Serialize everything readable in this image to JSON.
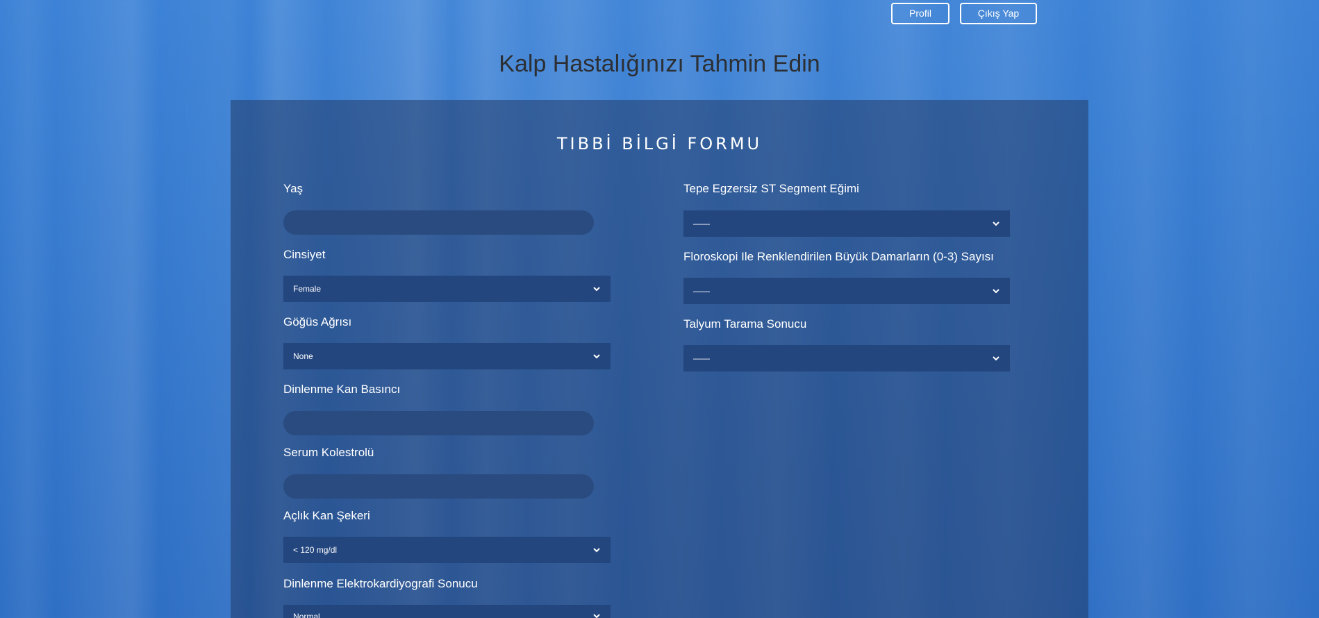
{
  "nav": {
    "profile_label": "Profil",
    "logout_label": "Çıkış Yap"
  },
  "page_title": "Kalp Hastalığınızı Tahmin Edin",
  "form": {
    "title": "TIBBİ BİLGİ FORMU",
    "left_fields": {
      "age": {
        "label": "Yaş",
        "value": ""
      },
      "sex": {
        "label": "Cinsiyet",
        "selected": "Female"
      },
      "chest_pain": {
        "label": "Göğüs Ağrısı",
        "selected": "None"
      },
      "resting_bp": {
        "label": "Dinlenme Kan Basıncı",
        "value": ""
      },
      "cholesterol": {
        "label": "Serum Kolestrolü",
        "value": ""
      },
      "fasting_sugar": {
        "label": "Açlık Kan Şekeri",
        "selected": "< 120 mg/dl"
      },
      "resting_ecg": {
        "label": "Dinlenme Elektrokardiyografi Sonucu",
        "selected": "Normal"
      }
    },
    "right_fields": {
      "st_slope": {
        "label": "Tepe Egzersiz ST Segment Eğimi",
        "selected": "——"
      },
      "vessels": {
        "label": "Floroskopi Ile Renklendirilen Büyük Damarların (0-3) Sayısı",
        "selected": "——"
      },
      "thallium": {
        "label": "Talyum Tarama Sonucu",
        "selected": "——"
      }
    }
  },
  "icons": {
    "select_indicator": "chevron-down-icon"
  },
  "colors": {
    "background": "#3577cf",
    "panel": "#223c6a",
    "input": "#2a4b7f",
    "select": "#23467e",
    "text": "#ffffff",
    "title": "#2c2f33"
  }
}
